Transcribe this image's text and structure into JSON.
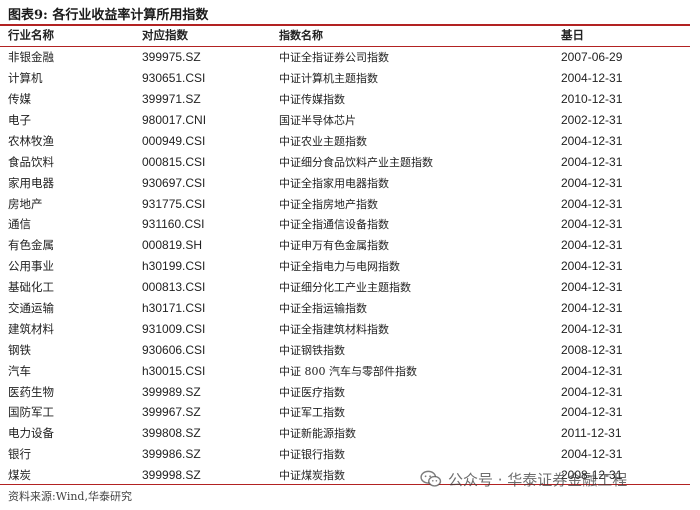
{
  "title": "图表9:  各行业收益率计算所用指数",
  "headers": [
    "行业名称",
    "对应指数",
    "指数名称",
    "基日"
  ],
  "rows": [
    [
      "非银金融",
      "399975.SZ",
      "中证全指证券公司指数",
      "2007-06-29"
    ],
    [
      "计算机",
      "930651.CSI",
      "中证计算机主题指数",
      "2004-12-31"
    ],
    [
      "传媒",
      "399971.SZ",
      "中证传媒指数",
      "2010-12-31"
    ],
    [
      "电子",
      "980017.CNI",
      "国证半导体芯片",
      "2002-12-31"
    ],
    [
      "农林牧渔",
      "000949.CSI",
      "中证农业主题指数",
      "2004-12-31"
    ],
    [
      "食品饮料",
      "000815.CSI",
      "中证细分食品饮料产业主题指数",
      "2004-12-31"
    ],
    [
      "家用电器",
      "930697.CSI",
      "中证全指家用电器指数",
      "2004-12-31"
    ],
    [
      "房地产",
      "931775.CSI",
      "中证全指房地产指数",
      "2004-12-31"
    ],
    [
      "通信",
      "931160.CSI",
      "中证全指通信设备指数",
      "2004-12-31"
    ],
    [
      "有色金属",
      "000819.SH",
      "中证申万有色金属指数",
      "2004-12-31"
    ],
    [
      "公用事业",
      "h30199.CSI",
      "中证全指电力与电网指数",
      "2004-12-31"
    ],
    [
      "基础化工",
      "000813.CSI",
      "中证细分化工产业主题指数",
      "2004-12-31"
    ],
    [
      "交通运输",
      "h30171.CSI",
      "中证全指运输指数",
      "2004-12-31"
    ],
    [
      "建筑材料",
      "931009.CSI",
      "中证全指建筑材料指数",
      "2004-12-31"
    ],
    [
      "钢铁",
      "930606.CSI",
      "中证钢铁指数",
      "2008-12-31"
    ],
    [
      "汽车",
      "h30015.CSI",
      "中证 800 汽车与零部件指数",
      "2004-12-31"
    ],
    [
      "医药生物",
      "399989.SZ",
      "中证医疗指数",
      "2004-12-31"
    ],
    [
      "国防军工",
      "399967.SZ",
      "中证军工指数",
      "2004-12-31"
    ],
    [
      "电力设备",
      "399808.SZ",
      "中证新能源指数",
      "2011-12-31"
    ],
    [
      "银行",
      "399986.SZ",
      "中证银行指数",
      "2004-12-31"
    ],
    [
      "煤炭",
      "399998.SZ",
      "中证煤炭指数",
      "2008-12-31"
    ]
  ],
  "source": "资料来源:Wind,华泰研究",
  "watermark": {
    "text": "公众号 · 华泰证券金融工程",
    "icon": "wechat-icon"
  },
  "colors": {
    "rule": "#b22222",
    "text": "#222222"
  }
}
